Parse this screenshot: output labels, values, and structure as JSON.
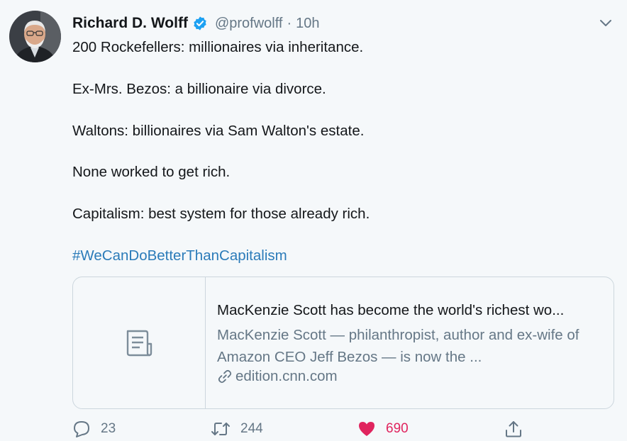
{
  "author": {
    "name": "Richard D. Wolff",
    "handle": "@profwolff",
    "separator": "·",
    "time": "10h",
    "verified": true
  },
  "tweet": {
    "lines": [
      "200 Rockefellers: millionaires via inheritance.",
      "Ex-Mrs. Bezos: a billionaire via divorce.",
      "Waltons: billionaires via Sam Walton's estate.",
      "None worked to get rich.",
      "Capitalism: best system for those already rich."
    ],
    "hashtag": "#WeCanDoBetterThanCapitalism"
  },
  "card": {
    "title": "MacKenzie Scott has become the world's richest wo...",
    "description": "MacKenzie Scott — philanthropist, author and ex-wife of Amazon CEO Jeff Bezos — is now the ...",
    "domain": "edition.cnn.com",
    "thumbnail_icon": "document-icon"
  },
  "actions": {
    "reply": {
      "icon": "reply-icon",
      "count": "23"
    },
    "retweet": {
      "icon": "retweet-icon",
      "count": "244"
    },
    "like": {
      "icon": "heart-icon",
      "count": "690",
      "liked": true
    },
    "share": {
      "icon": "share-icon"
    }
  },
  "colors": {
    "background": "#f5f8fa",
    "link": "#2b7bb9",
    "secondary_text": "#657786",
    "like": "#e0245e",
    "verified": "#1da1f2"
  }
}
